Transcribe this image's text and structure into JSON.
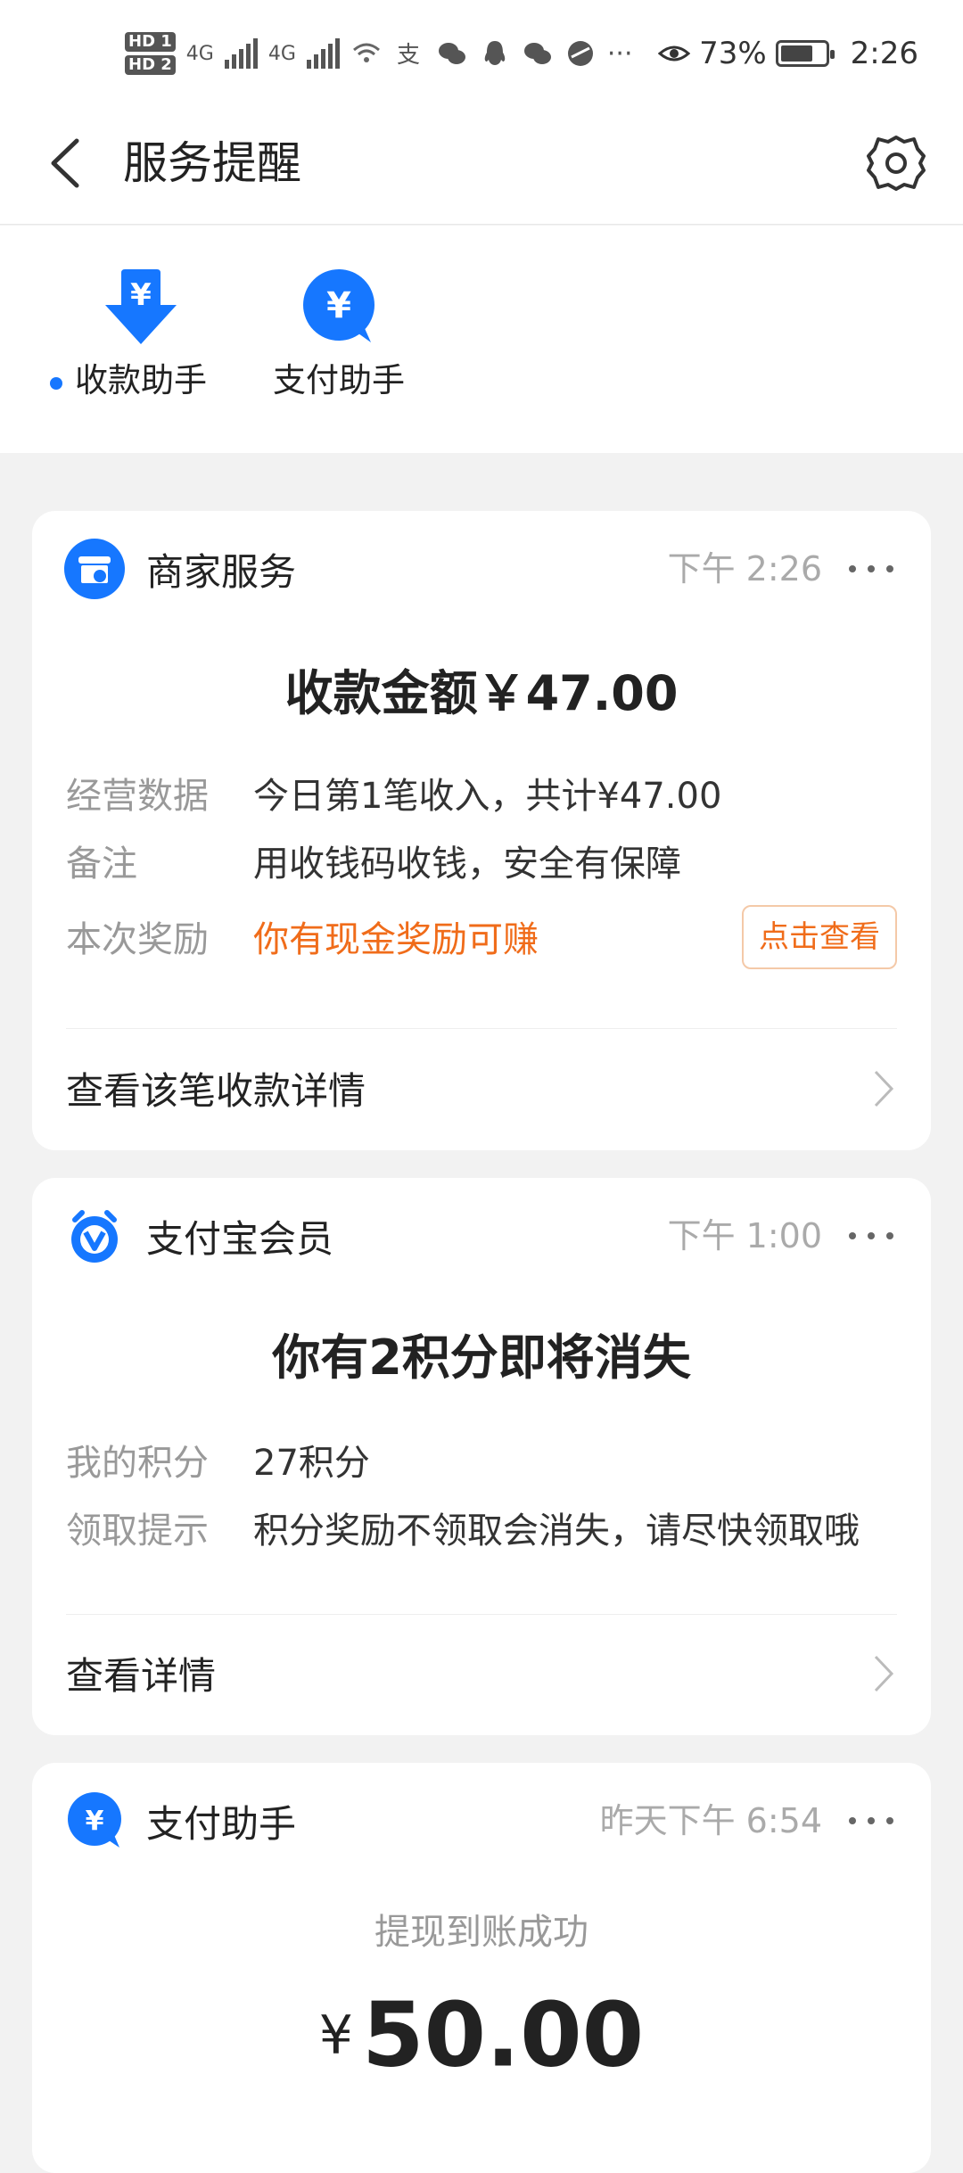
{
  "status_bar": {
    "battery_percent": "73%",
    "time": "2:26",
    "sim1": "HD 1",
    "sim2": "HD 2",
    "net1": "4G",
    "net2": "4G",
    "battery_level": 0.73
  },
  "header": {
    "title": "服务提醒"
  },
  "tabs": [
    {
      "label": "收款助手",
      "active": true
    },
    {
      "label": "支付助手",
      "active": false
    }
  ],
  "cards": {
    "merchant": {
      "source": "商家服务",
      "time": "下午 2:26",
      "headline": "收款金额￥47.00",
      "rows": [
        {
          "key": "经营数据",
          "value": "今日第1笔收入，共计¥47.00"
        },
        {
          "key": "备注",
          "value": "用收钱码收钱，安全有保障"
        },
        {
          "key": "本次奖励",
          "value": "你有现金奖励可赚"
        }
      ],
      "reward_button": "点击查看",
      "link": "查看该笔收款详情"
    },
    "member": {
      "source": "支付宝会员",
      "time": "下午 1:00",
      "headline": "你有2积分即将消失",
      "rows": [
        {
          "key": "我的积分",
          "value": "27积分"
        },
        {
          "key": "领取提示",
          "value": "积分奖励不领取会消失，请尽快领取哦"
        }
      ],
      "link": "查看详情"
    },
    "payment": {
      "source": "支付助手",
      "time": "昨天下午 6:54",
      "subtitle": "提现到账成功",
      "currency": "¥",
      "amount": "50.00"
    }
  },
  "colors": {
    "accent": "#1677ff",
    "orange": "#f06c1a",
    "background": "#f2f2f2"
  }
}
